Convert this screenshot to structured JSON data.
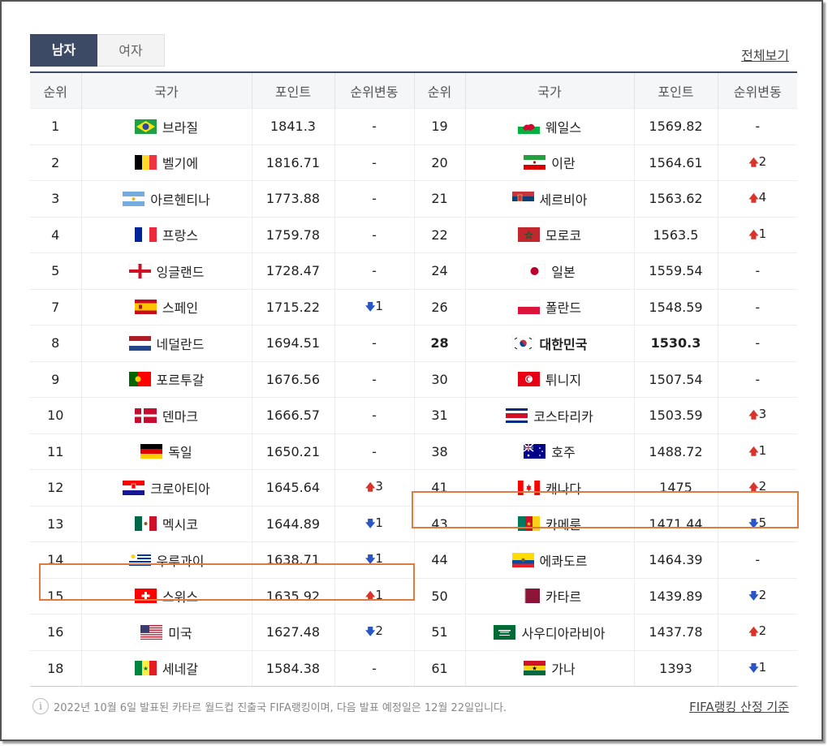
{
  "tabs": [
    {
      "label": "남자",
      "active": true
    },
    {
      "label": "여자",
      "active": false
    }
  ],
  "view_all": "전체보기",
  "headers": [
    "순위",
    "국가",
    "포인트",
    "순위변동",
    "순위",
    "국가",
    "포인트",
    "순위변동"
  ],
  "left_rows": [
    {
      "rank": "1",
      "country": "브라질",
      "flag": "brazil",
      "points": "1841.3",
      "change": {
        "dir": "none",
        "value": "-"
      }
    },
    {
      "rank": "2",
      "country": "벨기에",
      "flag": "belgium",
      "points": "1816.71",
      "change": {
        "dir": "none",
        "value": "-"
      }
    },
    {
      "rank": "3",
      "country": "아르헨티나",
      "flag": "argentina",
      "points": "1773.88",
      "change": {
        "dir": "none",
        "value": "-"
      }
    },
    {
      "rank": "4",
      "country": "프랑스",
      "flag": "france",
      "points": "1759.78",
      "change": {
        "dir": "none",
        "value": "-"
      }
    },
    {
      "rank": "5",
      "country": "잉글랜드",
      "flag": "england",
      "points": "1728.47",
      "change": {
        "dir": "none",
        "value": "-"
      }
    },
    {
      "rank": "7",
      "country": "스페인",
      "flag": "spain",
      "points": "1715.22",
      "change": {
        "dir": "down",
        "value": "1"
      }
    },
    {
      "rank": "8",
      "country": "네덜란드",
      "flag": "netherlands",
      "points": "1694.51",
      "change": {
        "dir": "none",
        "value": "-"
      }
    },
    {
      "rank": "9",
      "country": "포르투갈",
      "flag": "portugal",
      "points": "1676.56",
      "change": {
        "dir": "none",
        "value": "-"
      }
    },
    {
      "rank": "10",
      "country": "덴마크",
      "flag": "denmark",
      "points": "1666.57",
      "change": {
        "dir": "none",
        "value": "-"
      }
    },
    {
      "rank": "11",
      "country": "독일",
      "flag": "germany",
      "points": "1650.21",
      "change": {
        "dir": "none",
        "value": "-"
      }
    },
    {
      "rank": "12",
      "country": "크로아티아",
      "flag": "croatia",
      "points": "1645.64",
      "change": {
        "dir": "up",
        "value": "3"
      }
    },
    {
      "rank": "13",
      "country": "멕시코",
      "flag": "mexico",
      "points": "1644.89",
      "change": {
        "dir": "down",
        "value": "1"
      }
    },
    {
      "rank": "14",
      "country": "우루과이",
      "flag": "uruguay",
      "points": "1638.71",
      "change": {
        "dir": "down",
        "value": "1"
      }
    },
    {
      "rank": "15",
      "country": "스위스",
      "flag": "switzerland",
      "points": "1635.92",
      "change": {
        "dir": "up",
        "value": "1"
      }
    },
    {
      "rank": "16",
      "country": "미국",
      "flag": "usa",
      "points": "1627.48",
      "change": {
        "dir": "down",
        "value": "2"
      }
    },
    {
      "rank": "18",
      "country": "세네갈",
      "flag": "senegal",
      "points": "1584.38",
      "change": {
        "dir": "none",
        "value": "-"
      }
    }
  ],
  "right_rows": [
    {
      "rank": "19",
      "country": "웨일스",
      "flag": "wales",
      "points": "1569.82",
      "change": {
        "dir": "none",
        "value": "-"
      }
    },
    {
      "rank": "20",
      "country": "이란",
      "flag": "iran",
      "points": "1564.61",
      "change": {
        "dir": "up",
        "value": "2"
      }
    },
    {
      "rank": "21",
      "country": "세르비아",
      "flag": "serbia",
      "points": "1563.62",
      "change": {
        "dir": "up",
        "value": "4"
      }
    },
    {
      "rank": "22",
      "country": "모로코",
      "flag": "morocco",
      "points": "1563.5",
      "change": {
        "dir": "up",
        "value": "1"
      }
    },
    {
      "rank": "24",
      "country": "일본",
      "flag": "japan",
      "points": "1559.54",
      "change": {
        "dir": "none",
        "value": "-"
      }
    },
    {
      "rank": "26",
      "country": "폴란드",
      "flag": "poland",
      "points": "1548.59",
      "change": {
        "dir": "none",
        "value": "-"
      }
    },
    {
      "rank": "28",
      "country": "대한민국",
      "flag": "korea",
      "points": "1530.3",
      "change": {
        "dir": "none",
        "value": "-"
      },
      "bold": true
    },
    {
      "rank": "30",
      "country": "튀니지",
      "flag": "tunisia",
      "points": "1507.54",
      "change": {
        "dir": "none",
        "value": "-"
      }
    },
    {
      "rank": "31",
      "country": "코스타리카",
      "flag": "costarica",
      "points": "1503.59",
      "change": {
        "dir": "up",
        "value": "3"
      }
    },
    {
      "rank": "38",
      "country": "호주",
      "flag": "australia",
      "points": "1488.72",
      "change": {
        "dir": "up",
        "value": "1"
      }
    },
    {
      "rank": "41",
      "country": "캐나다",
      "flag": "canada",
      "points": "1475",
      "change": {
        "dir": "up",
        "value": "2"
      }
    },
    {
      "rank": "43",
      "country": "카메룬",
      "flag": "cameroon",
      "points": "1471.44",
      "change": {
        "dir": "down",
        "value": "5"
      }
    },
    {
      "rank": "44",
      "country": "에콰도르",
      "flag": "ecuador",
      "points": "1464.39",
      "change": {
        "dir": "none",
        "value": "-"
      }
    },
    {
      "rank": "50",
      "country": "카타르",
      "flag": "qatar",
      "points": "1439.89",
      "change": {
        "dir": "down",
        "value": "2"
      }
    },
    {
      "rank": "51",
      "country": "사우디아라비아",
      "flag": "saudi",
      "points": "1437.78",
      "change": {
        "dir": "up",
        "value": "2"
      }
    },
    {
      "rank": "61",
      "country": "가나",
      "flag": "ghana",
      "points": "1393",
      "change": {
        "dir": "down",
        "value": "1"
      }
    }
  ],
  "footer": {
    "note": "2022년 10월 6일 발표된 카타르 월드컵 진출국 FIFA랭킹이며, 다음 발표 예정일은 12월 22일입니다.",
    "info_icon_glyph": "i",
    "link": "FIFA랭킹 산정 기준"
  },
  "colors": {
    "header_bar": "#3d4a66",
    "up": "#d9342b",
    "down": "#2955c6",
    "highlight": "#e07a3e"
  }
}
